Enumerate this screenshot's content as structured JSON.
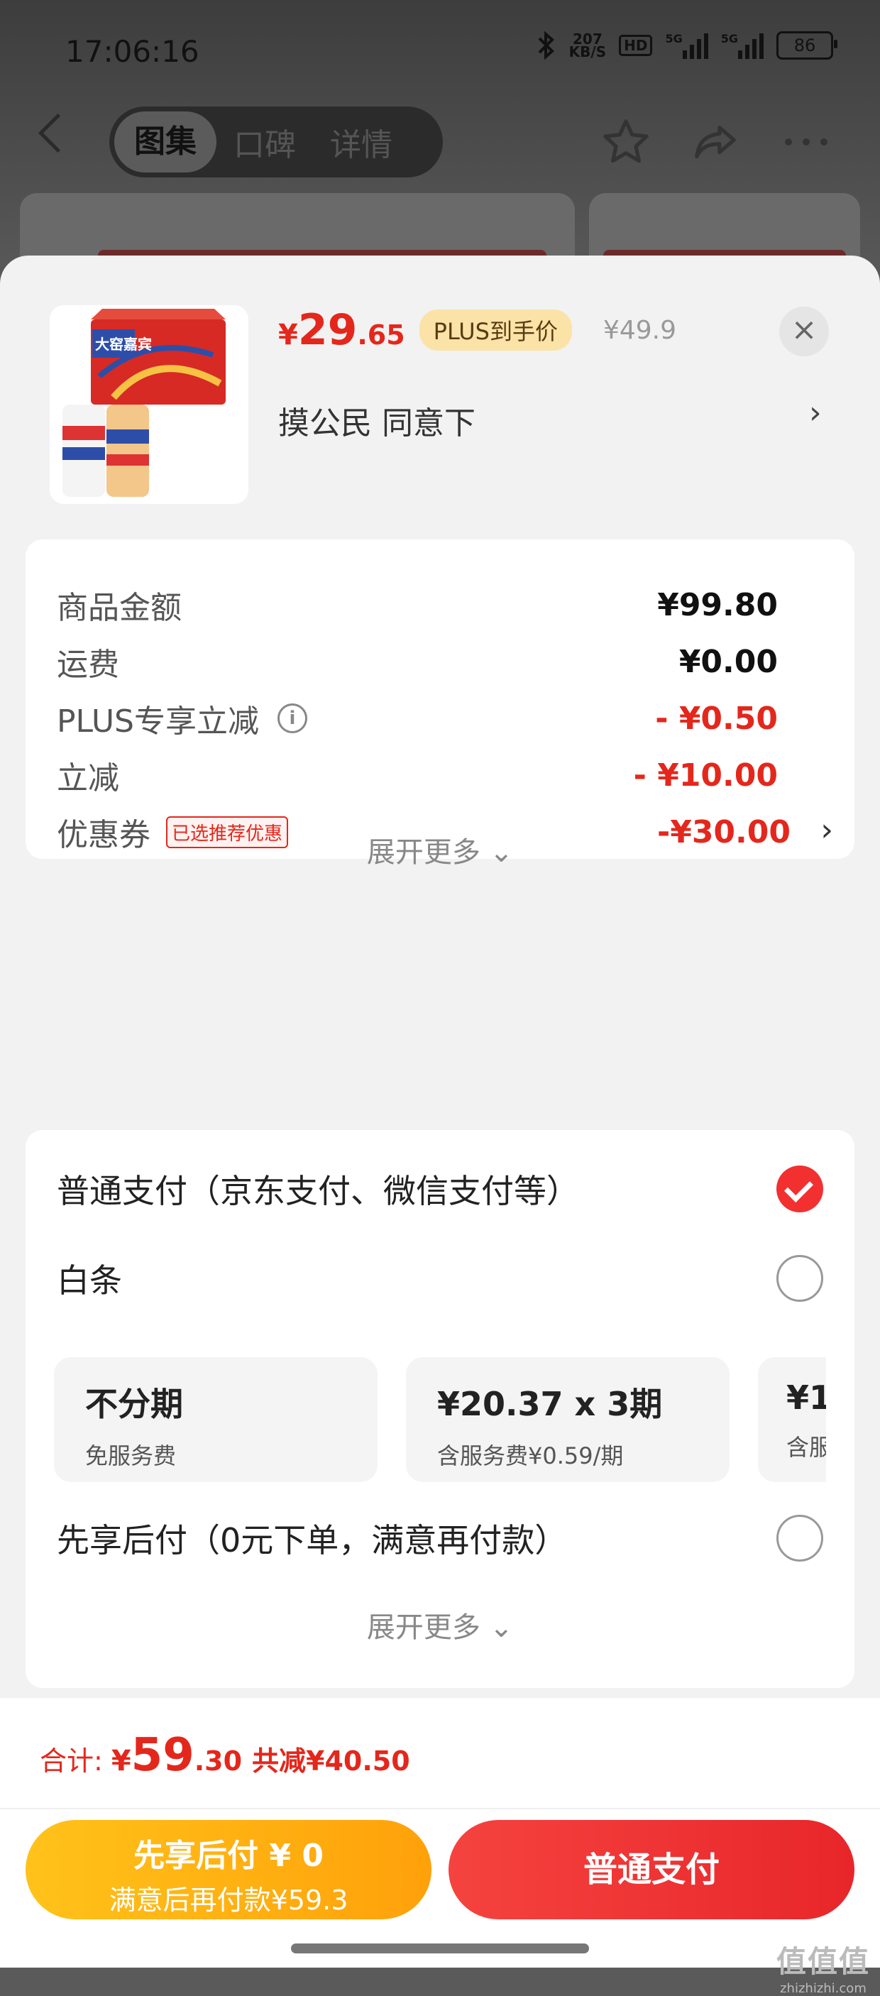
{
  "status_bar": {
    "time": "17:06:16",
    "net_speed_value": "207",
    "net_speed_unit": "KB/S",
    "hd_label": "HD",
    "signal_1": "5G",
    "signal_2": "5G",
    "battery": "86"
  },
  "nav": {
    "tabs": [
      "图集",
      "口碑",
      "详情"
    ]
  },
  "product": {
    "price_currency": "¥",
    "price_int": "29",
    "price_dec": ".65",
    "plus_label": "PLUS到手价",
    "original_price": "¥49.9",
    "close_icon": "×",
    "subtitle": "摸公民  同意下",
    "arrow": "›",
    "package_title": "大窑嘉宾"
  },
  "summary": {
    "rows": [
      {
        "label": "商品金额",
        "value": "¥99.80"
      },
      {
        "label": "运费",
        "value": "¥0.00"
      },
      {
        "label": "PLUS专享立减",
        "value": "- ¥0.50"
      },
      {
        "label": "立减",
        "value": "- ¥10.00"
      },
      {
        "label": "优惠券",
        "value": "-¥30.00",
        "tag": "已选推荐优惠"
      }
    ],
    "info_icon": "i",
    "expand_more": "展开更多 ⌄"
  },
  "payment": {
    "options": [
      {
        "label": "普通支付（京东支付、微信支付等）",
        "checked": true
      },
      {
        "label": "白条",
        "checked": false
      },
      {
        "label": "先享后付（0元下单，满意再付款）",
        "checked": false
      }
    ],
    "installments": [
      {
        "title": "不分期",
        "sub": "免服务费"
      },
      {
        "title": "¥20.37 x 3期",
        "sub": "含服务费¥0.59/期"
      },
      {
        "title": "¥1",
        "sub": "含服"
      }
    ],
    "expand_more": "展开更多 ⌄"
  },
  "bottom": {
    "total_label": "合计:",
    "currency": "¥",
    "total_int": "59",
    "total_dec": ".30",
    "saving": "共减¥40.50",
    "bnpl_line1": "先享后付 ¥ 0",
    "bnpl_line2": "满意后再付款¥59.3",
    "pay_button": "普通支付"
  },
  "watermark": {
    "line1": "值值值",
    "line2": "zhizhizhi.com"
  },
  "colors": {
    "accent_red": "#e4271c",
    "plus_badge_bg": "#fbe3a8",
    "bnpl_yellow": "#ffb20f",
    "pay_red": "#ee3333"
  }
}
